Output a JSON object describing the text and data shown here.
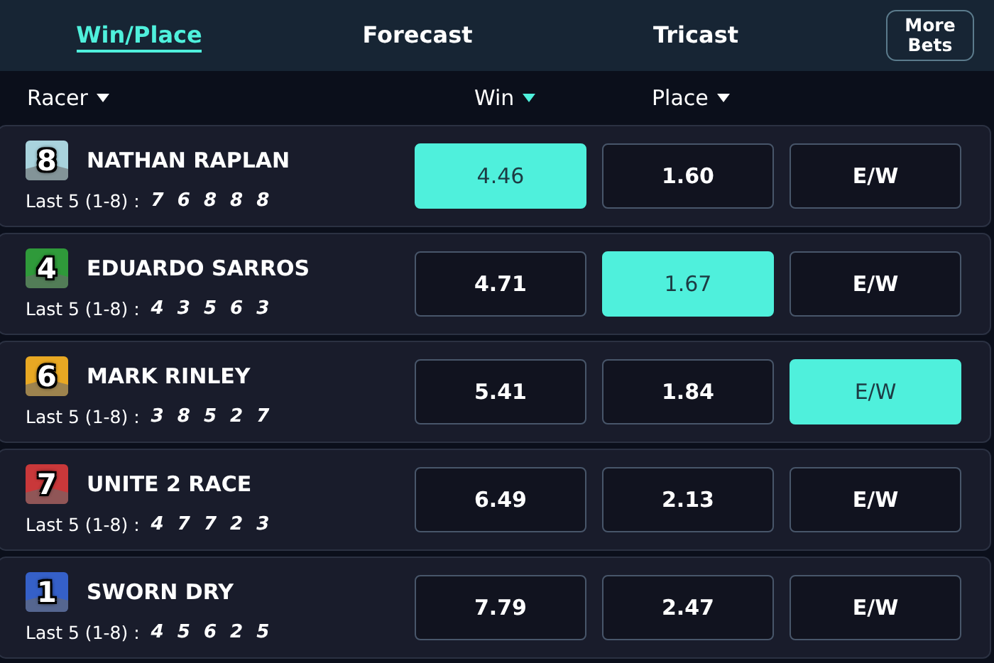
{
  "tabs": [
    {
      "label": "Win/Place",
      "selected": true
    },
    {
      "label": "Forecast",
      "selected": false
    },
    {
      "label": "Tricast",
      "selected": false
    }
  ],
  "more_bets": "More Bets",
  "columns": [
    {
      "label": "Racer",
      "sorted": false
    },
    {
      "label": "Win",
      "sorted": true
    },
    {
      "label": "Place",
      "sorted": false
    }
  ],
  "runners": [
    {
      "number": "8",
      "color": "#a9d3dd",
      "name": "NATHAN RAPLAN",
      "form_label": "Last 5 (1-8) :",
      "form": "7 6 8 8 8",
      "odds": [
        {
          "label": "4.46",
          "selected": true
        },
        {
          "label": "1.60",
          "selected": false
        },
        {
          "label": "E/W",
          "selected": false
        }
      ]
    },
    {
      "number": "4",
      "color": "#2f9a3a",
      "name": "EDUARDO SARROS",
      "form_label": "Last 5 (1-8) :",
      "form": "4 3 5 6 3",
      "odds": [
        {
          "label": "4.71",
          "selected": false
        },
        {
          "label": "1.67",
          "selected": true
        },
        {
          "label": "E/W",
          "selected": false
        }
      ]
    },
    {
      "number": "6",
      "color": "#e8a823",
      "name": "MARK RINLEY",
      "form_label": "Last 5 (1-8) :",
      "form": "3 8 5 2 7",
      "odds": [
        {
          "label": "5.41",
          "selected": false
        },
        {
          "label": "1.84",
          "selected": false
        },
        {
          "label": "E/W",
          "selected": true
        }
      ]
    },
    {
      "number": "7",
      "color": "#c9383a",
      "name": "UNITE 2 RACE",
      "form_label": "Last 5 (1-8) :",
      "form": "4 7 7 2 3",
      "odds": [
        {
          "label": "6.49",
          "selected": false
        },
        {
          "label": "2.13",
          "selected": false
        },
        {
          "label": "E/W",
          "selected": false
        }
      ]
    },
    {
      "number": "1",
      "color": "#3560c8",
      "name": "SWORN DRY",
      "form_label": "Last 5 (1-8) :",
      "form": "4 5 6 2 5",
      "odds": [
        {
          "label": "7.79",
          "selected": false
        },
        {
          "label": "2.47",
          "selected": false
        },
        {
          "label": "E/W",
          "selected": false
        }
      ]
    }
  ]
}
